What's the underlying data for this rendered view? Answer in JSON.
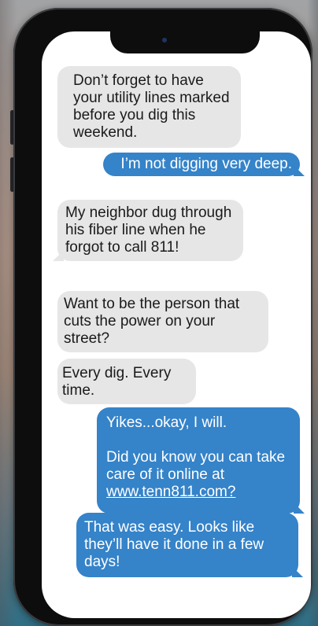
{
  "conversation": {
    "messages": [
      {
        "direction": "received",
        "text": "Don’t forget to have your utility lines marked before you dig this weekend."
      },
      {
        "direction": "sent",
        "text": "I’m not digging very deep."
      },
      {
        "direction": "received",
        "text": "My neighbor dug through his fiber line when he forgot to call 811!"
      },
      {
        "direction": "received",
        "text": "Want to be the person that cuts the power on your street?"
      },
      {
        "direction": "received",
        "text": "Every dig. Every time."
      },
      {
        "direction": "sent",
        "line1": "Yikes...okay, I will.",
        "line2": "Did you know you can take care of it online at",
        "link": "www.tenn811.com?"
      },
      {
        "direction": "sent",
        "text": "That was easy. Looks like they’ll have it done in a few days!"
      }
    ]
  },
  "colors": {
    "sent_bubble": "#3583c9",
    "received_bubble": "#e6e6e6",
    "phone_frame": "#0d0d0e",
    "screen": "#ffffff"
  },
  "icons": {
    "camera": "front-camera-icon"
  }
}
